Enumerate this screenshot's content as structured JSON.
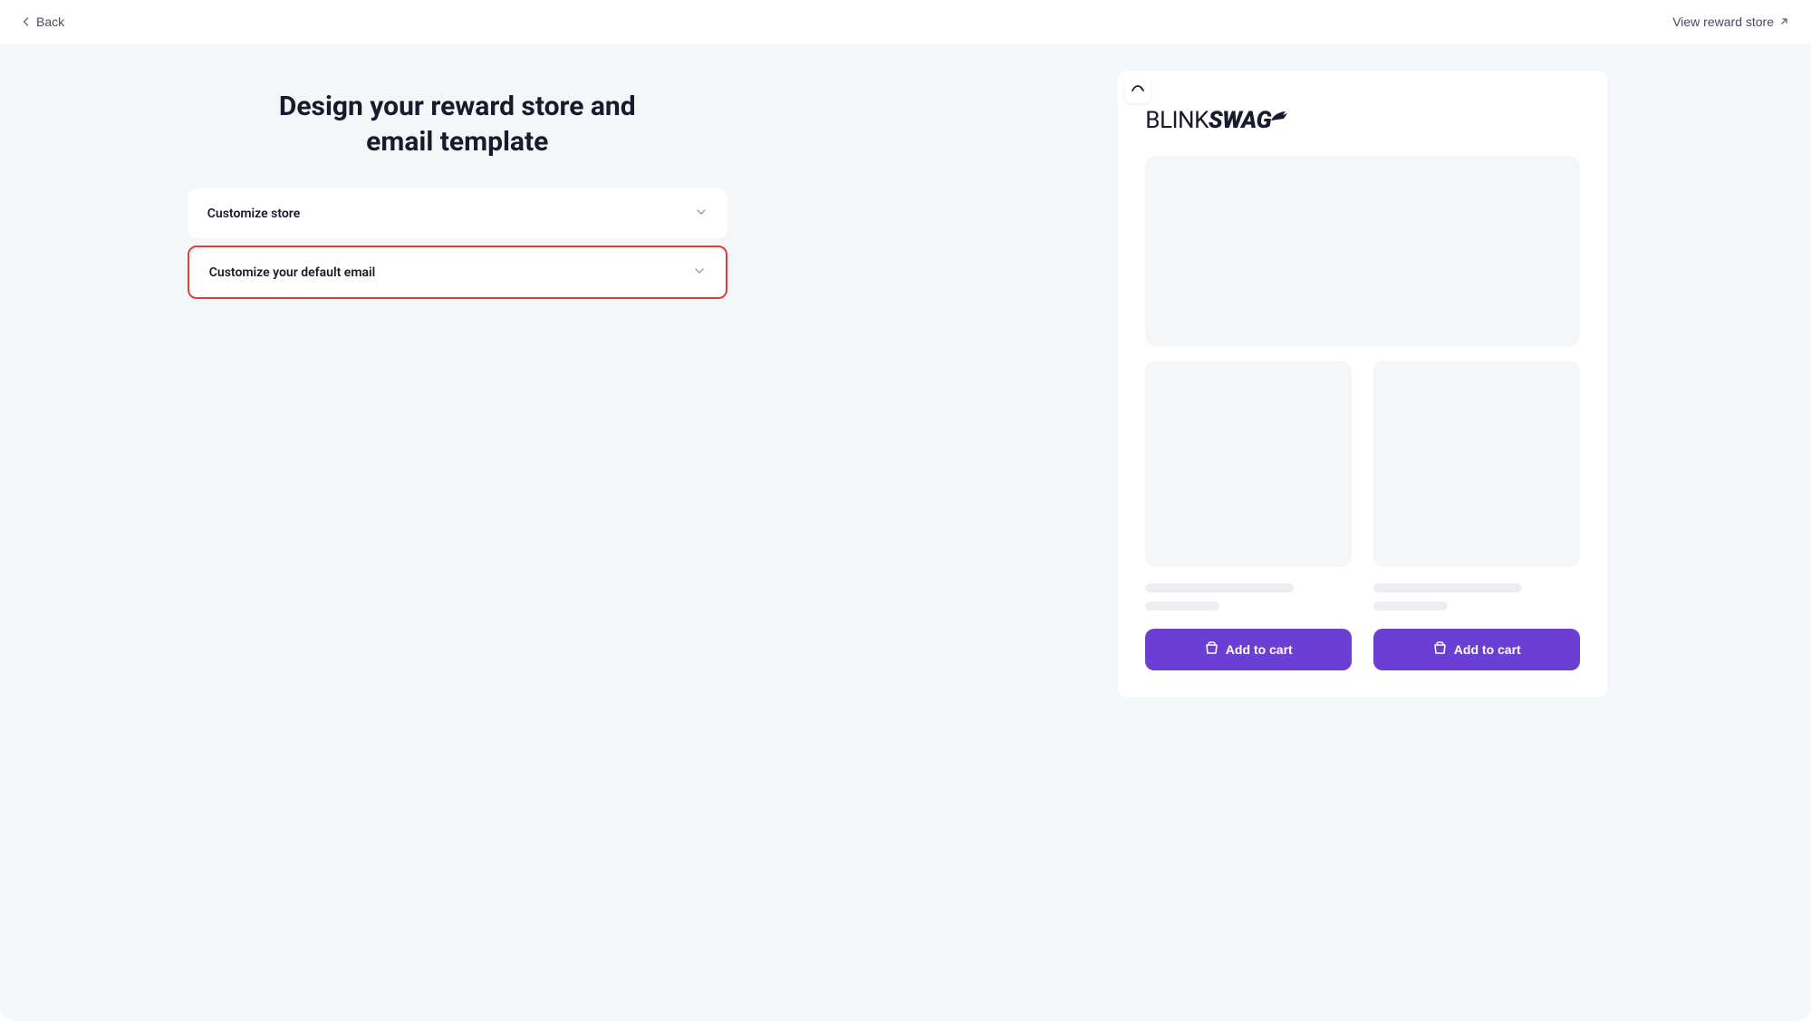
{
  "header": {
    "back_label": "Back",
    "view_store_label": "View reward store"
  },
  "page_title": "Design your reward store and email template",
  "accordions": [
    {
      "label": "Customize store",
      "highlighted": false
    },
    {
      "label": "Customize your default email",
      "highlighted": true
    }
  ],
  "preview": {
    "logo_part1": "BLINK",
    "logo_part2": "SWAG",
    "products": [
      {
        "button_label": "Add to cart"
      },
      {
        "button_label": "Add to cart"
      }
    ]
  },
  "colors": {
    "accent": "#6b3fd4",
    "highlight_border": "#e03e3e",
    "panel_bg": "#f5f6f8"
  }
}
